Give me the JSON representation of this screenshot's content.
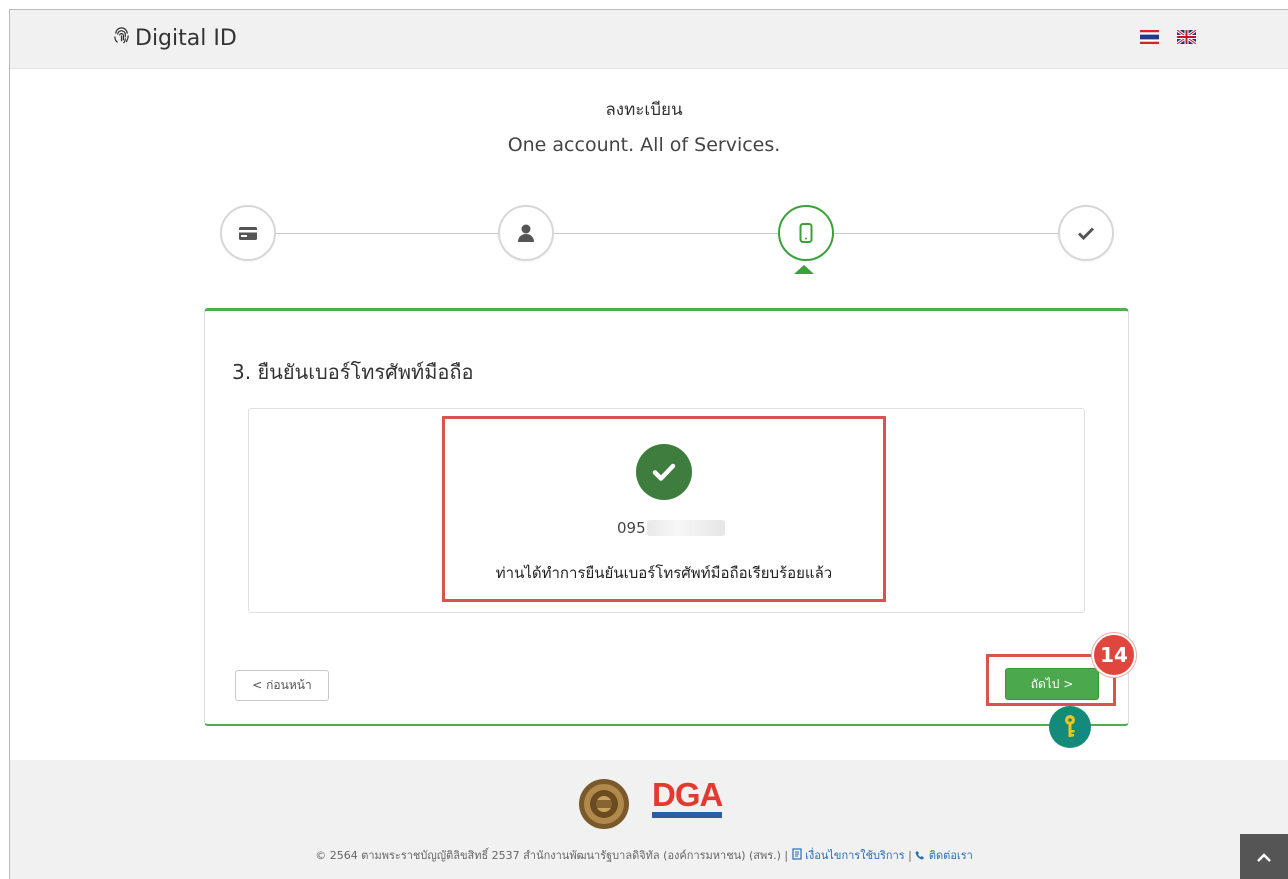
{
  "header": {
    "brand": "Digital ID",
    "brand_icon": "fingerprint-icon",
    "languages": [
      "th-flag",
      "uk-flag"
    ]
  },
  "page": {
    "title_th": "ลงทะเบียน",
    "subtitle_en": "One account. All of Services."
  },
  "stepper": {
    "steps": [
      {
        "icon": "id-card-icon",
        "state": "inactive"
      },
      {
        "icon": "user-icon",
        "state": "inactive"
      },
      {
        "icon": "mobile-icon",
        "state": "active"
      },
      {
        "icon": "check-icon",
        "state": "inactive"
      }
    ],
    "active_color": "#3aa03a"
  },
  "card": {
    "title": "3. ยืนยันเบอร์โทรศัพท์มือถือ",
    "phone_visible": "095",
    "success_message": "ท่านได้ทำการยืนยันเบอร์โทรศัพท์มือถือเรียบร้อยแล้ว",
    "success_color": "#3f7d3f"
  },
  "buttons": {
    "prev_label": "< ก่อนหน้า",
    "next_label": "ถัดไป >"
  },
  "annotation": {
    "badge_number": "14",
    "highlight_color": "#d9534f"
  },
  "footer": {
    "logo_text": "DGA",
    "copyright": "© 2564 ตามพระราชบัญญัติลิขสิทธิ์ 2537 สำนักงานพัฒนารัฐบาลดิจิทัล (องค์การมหาชน) (สพร.) |",
    "terms_link": "เงื่อนไขการใช้บริการ",
    "separator": "|",
    "contact_link": "ติดต่อเรา"
  }
}
